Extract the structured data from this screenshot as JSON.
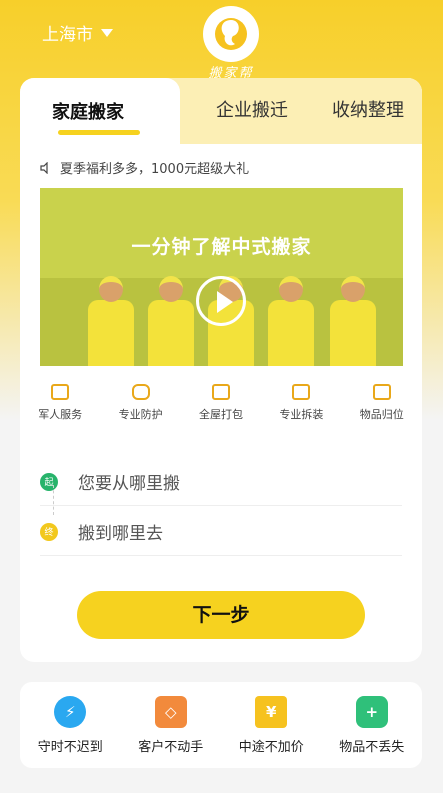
{
  "header": {
    "city": "上海市",
    "logo_text": "搬家帮"
  },
  "tabs": [
    {
      "label": "家庭搬家",
      "active": true
    },
    {
      "label": "企业搬迁",
      "active": false
    },
    {
      "label": "收纳整理",
      "active": false
    }
  ],
  "notice": {
    "icon": "speaker-icon",
    "text": "夏季福利多多，1000元超级大礼"
  },
  "video": {
    "title": "一分钟了解中式搬家"
  },
  "services": [
    {
      "label": "军人服务",
      "icon": "soldier-icon"
    },
    {
      "label": "专业防护",
      "icon": "shield-icon"
    },
    {
      "label": "全屋打包",
      "icon": "package-icon"
    },
    {
      "label": "专业拆装",
      "icon": "toolbox-icon"
    },
    {
      "label": "物品归位",
      "icon": "box-icon"
    }
  ],
  "route": {
    "from_marker": "起",
    "from_placeholder": "您要从哪里搬",
    "to_marker": "终",
    "to_placeholder": "搬到哪里去"
  },
  "next_button": "下一步",
  "perks": [
    {
      "label": "守时不迟到",
      "icon": "lightning-icon",
      "color": "#2aa8f0"
    },
    {
      "label": "客户不动手",
      "icon": "hexagon-icon",
      "color": "#f28a3c"
    },
    {
      "label": "中途不加价",
      "icon": "price-tag-icon",
      "color": "#f6c21f"
    },
    {
      "label": "物品不丢失",
      "icon": "shield-plus-icon",
      "color": "#2fc07a"
    }
  ],
  "colors": {
    "brand_yellow": "#f6d21f",
    "from_marker": "#27b36b",
    "to_marker": "#f2c81d"
  }
}
